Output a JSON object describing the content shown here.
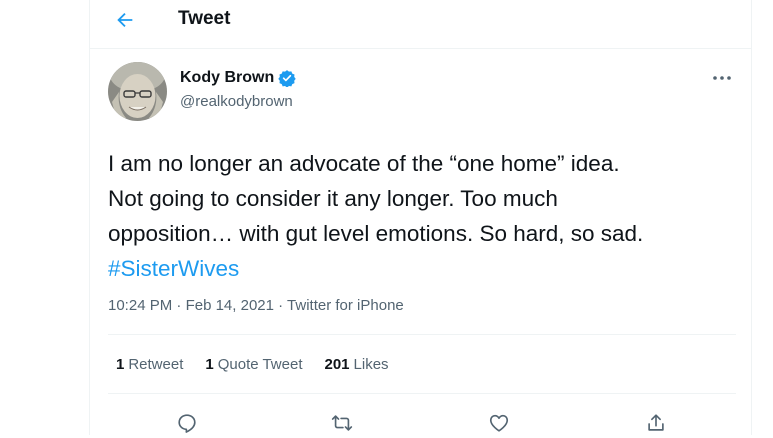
{
  "header": {
    "title": "Tweet"
  },
  "author": {
    "display_name": "Kody Brown",
    "handle": "@realkodybrown"
  },
  "tweet": {
    "lines": [
      "I am no longer an advocate of the “one home” idea.",
      "Not going to consider it any longer. Too much",
      "opposition… with gut level emotions. So hard, so sad."
    ],
    "hashtag": "#SisterWives"
  },
  "meta": {
    "time": "10:24 PM",
    "dot1": " · ",
    "date": "Feb 14, 2021",
    "dot2": " · ",
    "source": "Twitter for iPhone"
  },
  "stats": {
    "retweets": {
      "count": "1",
      "label": "Retweet"
    },
    "quotes": {
      "count": "1",
      "label": "Quote Tweet"
    },
    "likes": {
      "count": "201",
      "label": "Likes"
    }
  },
  "icons": {
    "back": "arrow-left",
    "verified": "verified-badge",
    "more": "more-horizontal",
    "reply": "reply",
    "retweet": "retweet",
    "like": "heart",
    "share": "share"
  },
  "colors": {
    "accent": "#1d9bf0",
    "text": "#0f1419",
    "muted": "#536471",
    "border": "#eff3f4"
  }
}
